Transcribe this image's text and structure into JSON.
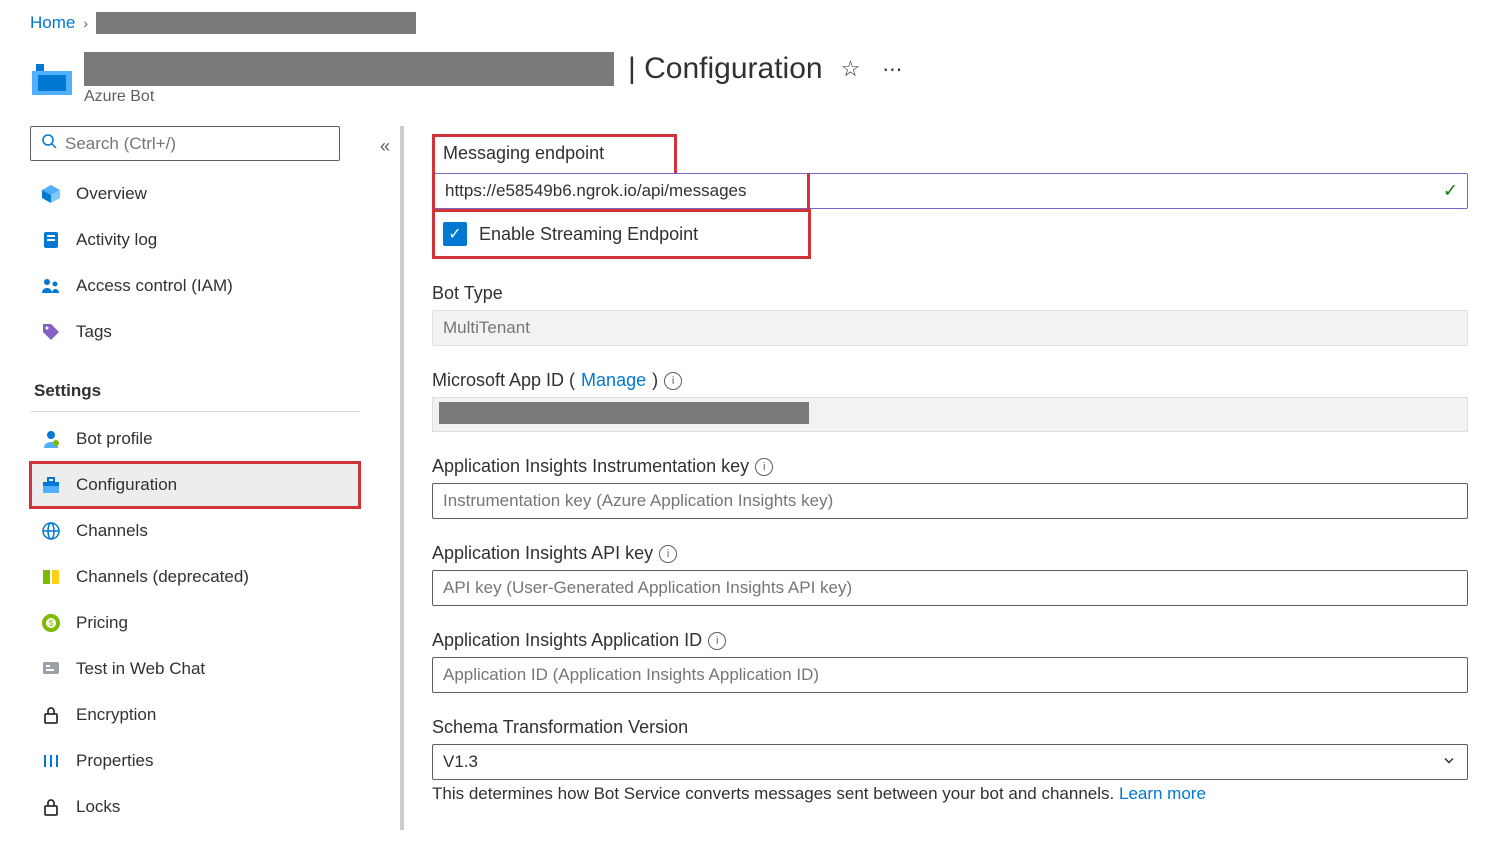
{
  "breadcrumb": {
    "home": "Home"
  },
  "header": {
    "title_suffix": "| Configuration",
    "subtitle": "Azure Bot"
  },
  "sidebar": {
    "search_placeholder": "Search (Ctrl+/)",
    "items_top": [
      {
        "label": "Overview"
      },
      {
        "label": "Activity log"
      },
      {
        "label": "Access control (IAM)"
      },
      {
        "label": "Tags"
      }
    ],
    "settings_header": "Settings",
    "items_settings": [
      {
        "label": "Bot profile"
      },
      {
        "label": "Configuration"
      },
      {
        "label": "Channels"
      },
      {
        "label": "Channels (deprecated)"
      },
      {
        "label": "Pricing"
      },
      {
        "label": "Test in Web Chat"
      },
      {
        "label": "Encryption"
      },
      {
        "label": "Properties"
      },
      {
        "label": "Locks"
      }
    ]
  },
  "form": {
    "messaging_endpoint": {
      "label": "Messaging endpoint",
      "value": "https://e58549b6.ngrok.io/api/messages"
    },
    "streaming": {
      "label": "Enable Streaming Endpoint",
      "checked": true
    },
    "bot_type": {
      "label": "Bot Type",
      "value": "MultiTenant"
    },
    "ms_app_id": {
      "label_prefix": "Microsoft App ID (",
      "manage": "Manage",
      "label_suffix": ")"
    },
    "ai_instr": {
      "label": "Application Insights Instrumentation key",
      "placeholder": "Instrumentation key (Azure Application Insights key)"
    },
    "ai_api": {
      "label": "Application Insights API key",
      "placeholder": "API key (User-Generated Application Insights API key)"
    },
    "ai_app": {
      "label": "Application Insights Application ID",
      "placeholder": "Application ID (Application Insights Application ID)"
    },
    "schema": {
      "label": "Schema Transformation Version",
      "value": "V1.3",
      "helper": "This determines how Bot Service converts messages sent between your bot and channels. ",
      "learn_more": "Learn more"
    }
  }
}
